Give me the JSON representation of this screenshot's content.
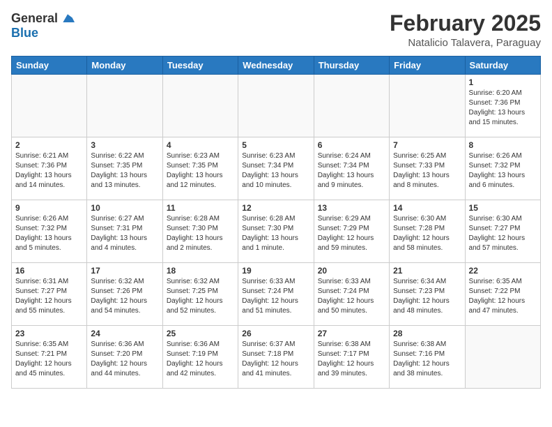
{
  "header": {
    "logo_general": "General",
    "logo_blue": "Blue",
    "month_title": "February 2025",
    "location": "Natalicio Talavera, Paraguay"
  },
  "weekdays": [
    "Sunday",
    "Monday",
    "Tuesday",
    "Wednesday",
    "Thursday",
    "Friday",
    "Saturday"
  ],
  "weeks": [
    [
      {
        "day": "",
        "info": ""
      },
      {
        "day": "",
        "info": ""
      },
      {
        "day": "",
        "info": ""
      },
      {
        "day": "",
        "info": ""
      },
      {
        "day": "",
        "info": ""
      },
      {
        "day": "",
        "info": ""
      },
      {
        "day": "1",
        "info": "Sunrise: 6:20 AM\nSunset: 7:36 PM\nDaylight: 13 hours\nand 15 minutes."
      }
    ],
    [
      {
        "day": "2",
        "info": "Sunrise: 6:21 AM\nSunset: 7:36 PM\nDaylight: 13 hours\nand 14 minutes."
      },
      {
        "day": "3",
        "info": "Sunrise: 6:22 AM\nSunset: 7:35 PM\nDaylight: 13 hours\nand 13 minutes."
      },
      {
        "day": "4",
        "info": "Sunrise: 6:23 AM\nSunset: 7:35 PM\nDaylight: 13 hours\nand 12 minutes."
      },
      {
        "day": "5",
        "info": "Sunrise: 6:23 AM\nSunset: 7:34 PM\nDaylight: 13 hours\nand 10 minutes."
      },
      {
        "day": "6",
        "info": "Sunrise: 6:24 AM\nSunset: 7:34 PM\nDaylight: 13 hours\nand 9 minutes."
      },
      {
        "day": "7",
        "info": "Sunrise: 6:25 AM\nSunset: 7:33 PM\nDaylight: 13 hours\nand 8 minutes."
      },
      {
        "day": "8",
        "info": "Sunrise: 6:26 AM\nSunset: 7:32 PM\nDaylight: 13 hours\nand 6 minutes."
      }
    ],
    [
      {
        "day": "9",
        "info": "Sunrise: 6:26 AM\nSunset: 7:32 PM\nDaylight: 13 hours\nand 5 minutes."
      },
      {
        "day": "10",
        "info": "Sunrise: 6:27 AM\nSunset: 7:31 PM\nDaylight: 13 hours\nand 4 minutes."
      },
      {
        "day": "11",
        "info": "Sunrise: 6:28 AM\nSunset: 7:30 PM\nDaylight: 13 hours\nand 2 minutes."
      },
      {
        "day": "12",
        "info": "Sunrise: 6:28 AM\nSunset: 7:30 PM\nDaylight: 13 hours\nand 1 minute."
      },
      {
        "day": "13",
        "info": "Sunrise: 6:29 AM\nSunset: 7:29 PM\nDaylight: 12 hours\nand 59 minutes."
      },
      {
        "day": "14",
        "info": "Sunrise: 6:30 AM\nSunset: 7:28 PM\nDaylight: 12 hours\nand 58 minutes."
      },
      {
        "day": "15",
        "info": "Sunrise: 6:30 AM\nSunset: 7:27 PM\nDaylight: 12 hours\nand 57 minutes."
      }
    ],
    [
      {
        "day": "16",
        "info": "Sunrise: 6:31 AM\nSunset: 7:27 PM\nDaylight: 12 hours\nand 55 minutes."
      },
      {
        "day": "17",
        "info": "Sunrise: 6:32 AM\nSunset: 7:26 PM\nDaylight: 12 hours\nand 54 minutes."
      },
      {
        "day": "18",
        "info": "Sunrise: 6:32 AM\nSunset: 7:25 PM\nDaylight: 12 hours\nand 52 minutes."
      },
      {
        "day": "19",
        "info": "Sunrise: 6:33 AM\nSunset: 7:24 PM\nDaylight: 12 hours\nand 51 minutes."
      },
      {
        "day": "20",
        "info": "Sunrise: 6:33 AM\nSunset: 7:24 PM\nDaylight: 12 hours\nand 50 minutes."
      },
      {
        "day": "21",
        "info": "Sunrise: 6:34 AM\nSunset: 7:23 PM\nDaylight: 12 hours\nand 48 minutes."
      },
      {
        "day": "22",
        "info": "Sunrise: 6:35 AM\nSunset: 7:22 PM\nDaylight: 12 hours\nand 47 minutes."
      }
    ],
    [
      {
        "day": "23",
        "info": "Sunrise: 6:35 AM\nSunset: 7:21 PM\nDaylight: 12 hours\nand 45 minutes."
      },
      {
        "day": "24",
        "info": "Sunrise: 6:36 AM\nSunset: 7:20 PM\nDaylight: 12 hours\nand 44 minutes."
      },
      {
        "day": "25",
        "info": "Sunrise: 6:36 AM\nSunset: 7:19 PM\nDaylight: 12 hours\nand 42 minutes."
      },
      {
        "day": "26",
        "info": "Sunrise: 6:37 AM\nSunset: 7:18 PM\nDaylight: 12 hours\nand 41 minutes."
      },
      {
        "day": "27",
        "info": "Sunrise: 6:38 AM\nSunset: 7:17 PM\nDaylight: 12 hours\nand 39 minutes."
      },
      {
        "day": "28",
        "info": "Sunrise: 6:38 AM\nSunset: 7:16 PM\nDaylight: 12 hours\nand 38 minutes."
      },
      {
        "day": "",
        "info": ""
      }
    ]
  ]
}
